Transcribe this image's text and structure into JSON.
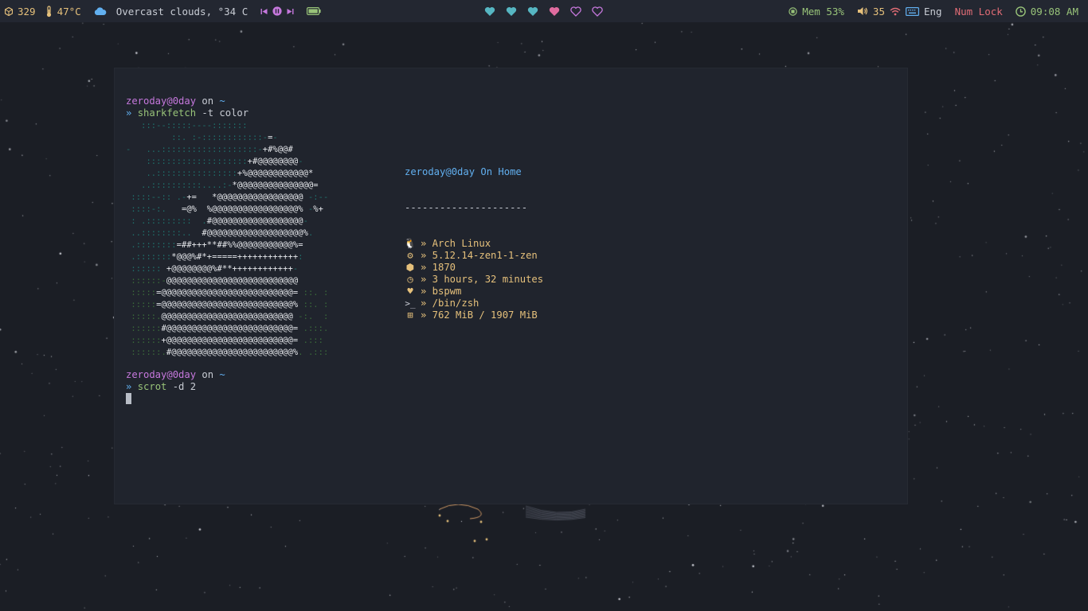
{
  "topbar": {
    "updates_count": "329",
    "temperature": "47°C",
    "weather_text": "Overcast clouds, °34 C",
    "battery_icon": "battery-icon",
    "workspaces": [
      {
        "state": "occupied",
        "color": "#56b6c2"
      },
      {
        "state": "occupied",
        "color": "#56b6c2"
      },
      {
        "state": "occupied",
        "color": "#56b6c2"
      },
      {
        "state": "focused",
        "color": "#e06c9f"
      },
      {
        "state": "empty",
        "color": "#c678dd"
      },
      {
        "state": "empty",
        "color": "#c678dd"
      }
    ],
    "memory": "Mem 53%",
    "volume": "35",
    "keyboard_layout": "Eng",
    "num_lock": "Num Lock",
    "clock": "09:08 AM",
    "colors": {
      "updates": "#e5c07b",
      "temp": "#e5c07b",
      "weather": "#61afef",
      "media": "#c678dd",
      "battery": "#98c379",
      "mem": "#98c379",
      "volume": "#e5c07b",
      "wifi": "#e06c75",
      "keyboard": "#61afef",
      "numlock": "#e06c75",
      "clock": "#98c379"
    }
  },
  "terminal": {
    "prompt1_user": "zeroday@0day",
    "prompt1_on": " on ",
    "prompt1_dir": "~",
    "prompt1_arrow": "»",
    "cmd1_name": "sharkfetch",
    "cmd1_args": " -t color",
    "prompt2_user": "zeroday@0day",
    "prompt2_on": " on ",
    "prompt2_dir": "~",
    "prompt2_arrow": "»",
    "cmd2_name": "scrot",
    "cmd2_args": " -d 2",
    "ascii_art": [
      "   :::--:::::----:::::::",
      "         ::. :-::::::::::::-=-",
      "-   ...:::::::::::::::::::-+#%@@#",
      "    ::::::::::::::::::::+#@@@@@@@@-",
      "    ..::::::::::::::::+%@@@@@@@@@@@@*",
      "   ..::::::::::....:-*@@@@@@@@@@@@@@@=",
      " ::::--:: .-+=   *@@@@@@@@@@@@@@@@@ -:--",
      " ::::-:.   =@%  %@@@@@@@@@@@@@@@@@% -%+",
      " : .:::::::::  .#@@@@@@@@@@@@@@@@@@-",
      " ..::::::::..  #@@@@@@@@@@@@@@@@@@@%.",
      " .::::::::=##+++**##%%@@@@@@@@@@@%=",
      " .:::::::*@@@%#*+=====++++++++++++:",
      " :::::: +@@@@@@@@%#**++++++++++++-",
      " ::::::-@@@@@@@@@@@@@@@@@@@@@@@@@@",
      " :::::=@@@@@@@@@@@@@@@@@@@@@@@@@@= ::. :",
      " :::::=@@@@@@@@@@@@@@@@@@@@@@@@@@% ::. :",
      " :::::.@@@@@@@@@@@@@@@@@@@@@@@@@@ -:.  :",
      " ::::::#@@@@@@@@@@@@@@@@@@@@@@@@@= .:::.",
      " ::::::+@@@@@@@@@@@@@@@@@@@@@@@@@= .:::",
      " ::::::.#@@@@@@@@@@@@@@@@@@@@@@@@%. .:::"
    ],
    "info_header": "zeroday@0day On Home",
    "info_divider": "---------------------",
    "info_rows": [
      {
        "icon": "linux-penguin-icon",
        "glyph": "🐧",
        "text": "» Arch Linux"
      },
      {
        "icon": "gear-icon",
        "glyph": "⚙",
        "text": "» 5.12.14-zen1-1-zen"
      },
      {
        "icon": "package-icon",
        "glyph": "⬢",
        "text": "» 1870"
      },
      {
        "icon": "clock-icon",
        "glyph": "◷",
        "text": "» 3 hours, 32 minutes"
      },
      {
        "icon": "heart-icon",
        "glyph": "♥",
        "text": "» bspwm"
      },
      {
        "icon": "terminal-prompt-icon",
        "glyph": ">_",
        "text": "» /bin/zsh"
      },
      {
        "icon": "memory-chip-icon",
        "glyph": "⊞",
        "text": "» 762 MiB / 1907 MiB"
      }
    ]
  }
}
